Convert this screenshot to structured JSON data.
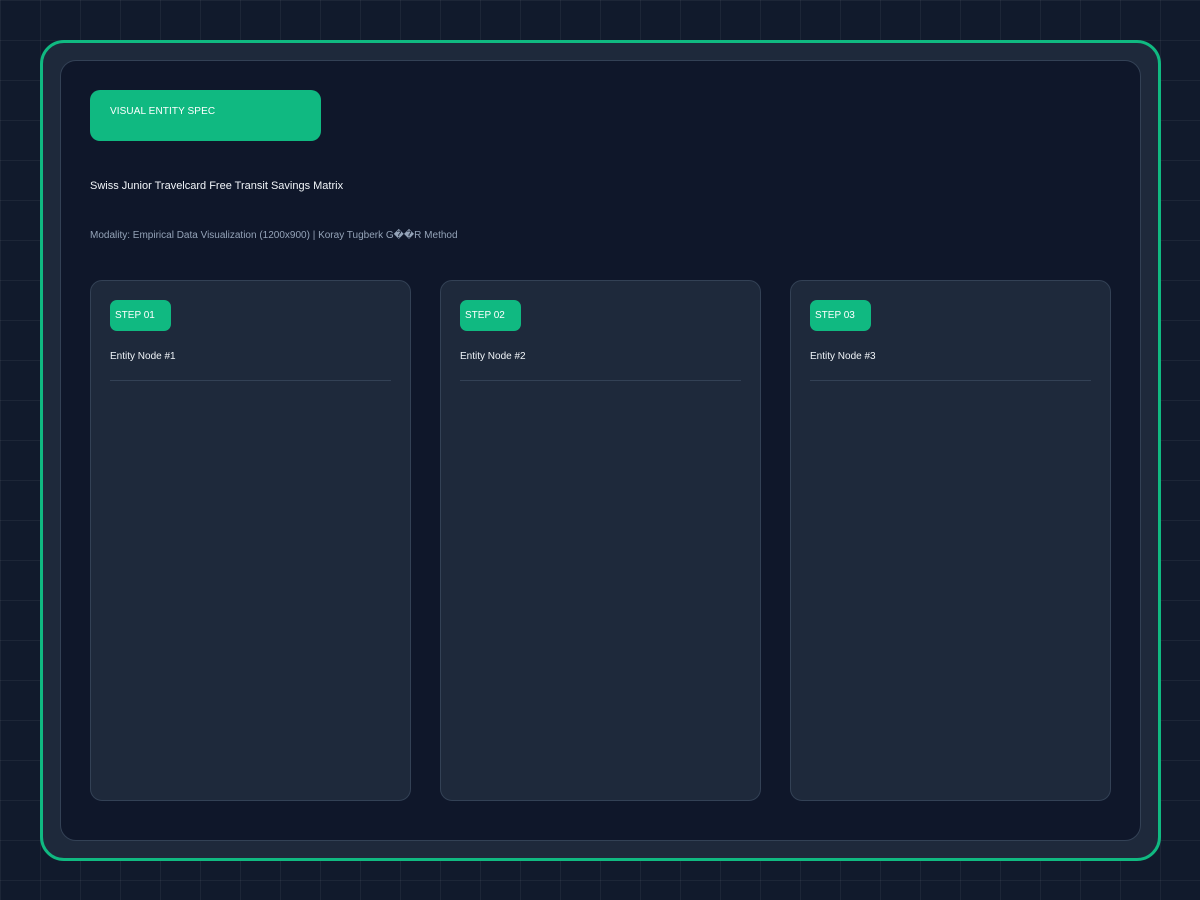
{
  "header": {
    "badge": "VISUAL ENTITY SPEC",
    "title": "Swiss Junior Travelcard Free Transit Savings Matrix",
    "modality": "Modality: Empirical Data Visualization (1200x900) | Koray Tugberk G��R Method"
  },
  "steps": [
    {
      "badge": "STEP 01",
      "title": "Entity Node #1"
    },
    {
      "badge": "STEP 02",
      "title": "Entity Node #2"
    },
    {
      "badge": "STEP 03",
      "title": "Entity Node #3"
    }
  ],
  "colors": {
    "accent": "#10b981",
    "background": "#111a2c",
    "panel": "#0f172a",
    "card": "#1e293b",
    "border": "#334155"
  }
}
